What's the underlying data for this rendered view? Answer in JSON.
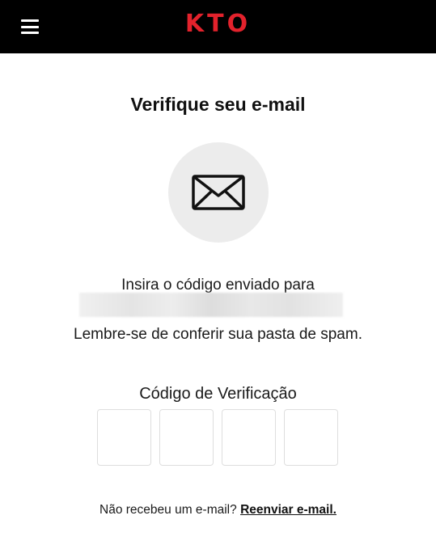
{
  "header": {
    "logo_text": "KTO",
    "menu_icon": "hamburger-menu-icon",
    "brand_color": "#e3222c",
    "background": "#000000"
  },
  "main": {
    "title": "Verifique seu e-mail",
    "mail_icon": "envelope-icon",
    "instruction": "Insira o código enviado para",
    "spam_notice": "Lembre-se de conferir sua pasta de spam.",
    "code_label": "Código de Verificação",
    "code_digits": [
      "",
      "",
      "",
      ""
    ],
    "resend_prompt": "Não recebeu um e-mail?",
    "resend_link": "Reenviar e-mail."
  }
}
